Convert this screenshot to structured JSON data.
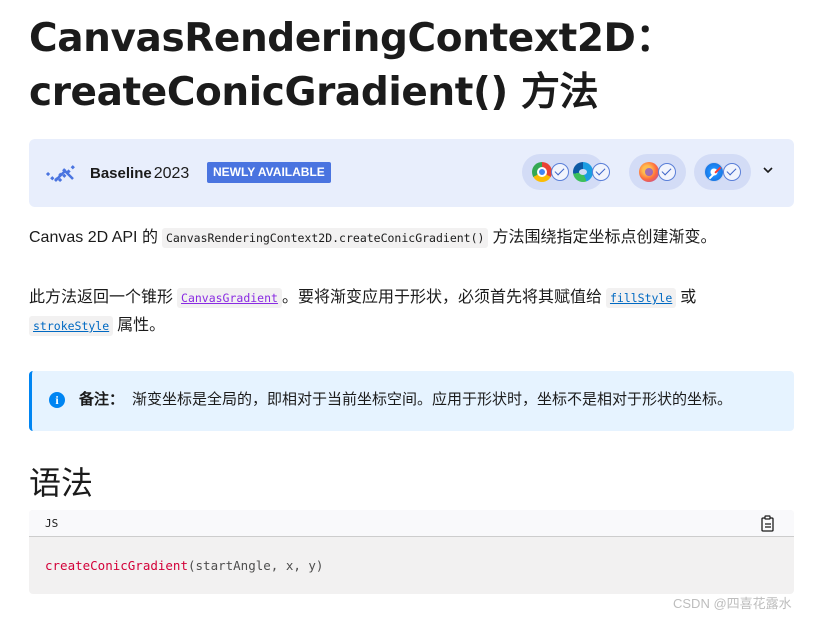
{
  "page": {
    "title_line1": "CanvasRenderingContext2D：",
    "title_line2": "createConicGradient() 方法"
  },
  "baseline": {
    "label": "Baseline",
    "year": "2023",
    "badge": "NEWLY AVAILABLE",
    "browsers": [
      "chrome-icon",
      "edge-icon",
      "firefox-icon",
      "safari-icon"
    ]
  },
  "intro": {
    "prefix": "Canvas 2D API 的",
    "code": "CanvasRenderingContext2D.createConicGradient()",
    "suffix": "方法围绕指定坐标点创建渐变。"
  },
  "returns": {
    "prefix": "此方法返回一个锥形",
    "link1": "CanvasGradient",
    "middle": "。要将渐变应用于形状，必须首先将其赋值给",
    "link2": "fillStyle",
    "or": "或",
    "link3": "strokeStyle",
    "suffix": "属性。"
  },
  "note": {
    "label": "备注：",
    "text": "渐变坐标是全局的，即相对于当前坐标空间。应用于形状时，坐标不是相对于形状的坐标。"
  },
  "syntax": {
    "heading": "语法",
    "lang": "JS",
    "fn": "createConicGradient",
    "args": "(startAngle, x, y)"
  },
  "watermark": "CSDN @四喜花露水",
  "colors": {
    "baseline_bg": "#e8eefc",
    "badge": "#4a74e0",
    "note_bg": "#e6f3ff",
    "note_accent": "#0085f2",
    "link": "#0069c2",
    "visited_link": "#8a2be2",
    "code_fn": "#d30038"
  }
}
